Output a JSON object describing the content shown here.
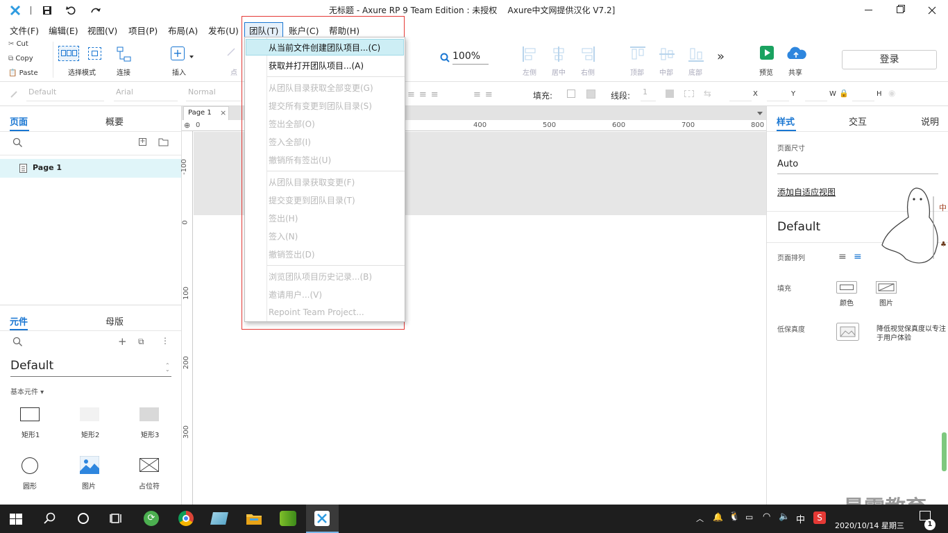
{
  "window": {
    "title": "无标题 - Axure RP 9 Team Edition : 未授权    Axure中文网提供汉化 V7.2]"
  },
  "menubar": {
    "items": [
      {
        "label": "文件(F)"
      },
      {
        "label": "编辑(E)"
      },
      {
        "label": "视图(V)"
      },
      {
        "label": "项目(P)"
      },
      {
        "label": "布局(A)"
      },
      {
        "label": "发布(U)"
      },
      {
        "label": "团队(T)"
      },
      {
        "label": "账户(C)"
      },
      {
        "label": "帮助(H)"
      }
    ]
  },
  "clipboard": {
    "cut": "Cut",
    "copy": "Copy",
    "paste": "Paste"
  },
  "toolbar": {
    "select_mode": "选择模式",
    "connect": "连接",
    "insert": "插入",
    "point": "点",
    "zoom": "100%",
    "align_left": "左侧",
    "align_center": "居中",
    "align_right": "右侧",
    "align_top": "顶部",
    "align_middle": "中部",
    "align_bottom": "底部",
    "preview": "预览",
    "share": "共享",
    "login": "登录"
  },
  "format": {
    "style": "Default",
    "font": "Arial",
    "weight": "Normal",
    "fill_label": "填充:",
    "stroke_label": "线段:",
    "stroke_value": "1",
    "x": "X",
    "y": "Y",
    "w": "W",
    "h": "H"
  },
  "pages_panel": {
    "tab_pages": "页面",
    "tab_outline": "概要",
    "page": "Page 1"
  },
  "widgets_panel": {
    "tab_widgets": "元件",
    "tab_masters": "母版",
    "library": "Default",
    "category": "基本元件 ▾",
    "items": [
      {
        "label": "矩形1",
        "icon": "rectangle-outline"
      },
      {
        "label": "矩形2",
        "icon": "rectangle-light"
      },
      {
        "label": "矩形3",
        "icon": "rectangle-gray"
      },
      {
        "label": "圆形",
        "icon": "circle"
      },
      {
        "label": "图片",
        "icon": "image"
      },
      {
        "label": "占位符",
        "icon": "placeholder"
      }
    ]
  },
  "canvas": {
    "tab": "Page 1",
    "ruler_x": [
      "0",
      "400",
      "500",
      "600",
      "700",
      "800"
    ],
    "ruler_y": [
      "-100",
      "0",
      "100",
      "200",
      "300"
    ]
  },
  "team_menu": {
    "items": [
      {
        "label": "从当前文件创建团队项目...(C)",
        "enabled": true,
        "highlighted": true
      },
      {
        "label": "获取并打开团队项目...(A)",
        "enabled": true
      },
      {
        "label": "从团队目录获取全部变更(G)",
        "enabled": false
      },
      {
        "label": "提交所有变更到团队目录(S)",
        "enabled": false
      },
      {
        "label": "签出全部(O)",
        "enabled": false
      },
      {
        "label": "签入全部(I)",
        "enabled": false
      },
      {
        "label": "撤销所有签出(U)",
        "enabled": false
      },
      {
        "label": "从团队目录获取变更(F)",
        "enabled": false
      },
      {
        "label": "提交变更到团队目录(T)",
        "enabled": false
      },
      {
        "label": "签出(H)",
        "enabled": false
      },
      {
        "label": "签入(N)",
        "enabled": false
      },
      {
        "label": "撤销签出(D)",
        "enabled": false
      },
      {
        "label": "浏览团队项目历史记录...(B)",
        "enabled": false
      },
      {
        "label": "邀请用户...(V)",
        "enabled": false
      },
      {
        "label": "Repoint Team Project...",
        "enabled": false
      }
    ]
  },
  "right_panel": {
    "tab_style": "样式",
    "tab_interact": "交互",
    "tab_notes": "说明",
    "page_size_label": "页面尺寸",
    "page_size_value": "Auto",
    "adaptive_link": "添加自适应视图",
    "style_name": "Default",
    "page_align_label": "页面排列",
    "fill_label": "填充",
    "fill_color": "颜色",
    "fill_image": "图片",
    "low_fidelity_label": "低保真度",
    "low_fidelity_desc_1": "降低视觉保真度以专注",
    "low_fidelity_desc_2": "于用户体验"
  },
  "watermark": {
    "text": "最需教育"
  },
  "taskbar": {
    "date": "2020/10/14 星期三",
    "ime": "中",
    "badge": "1"
  },
  "colors": {
    "accent": "#1976d2",
    "menu_outline": "#e53935",
    "menu_highlight": "#cdeef5",
    "preview_green": "#1aa260",
    "share_blue": "#2e86de",
    "taskbar": "#1e1e1e"
  }
}
